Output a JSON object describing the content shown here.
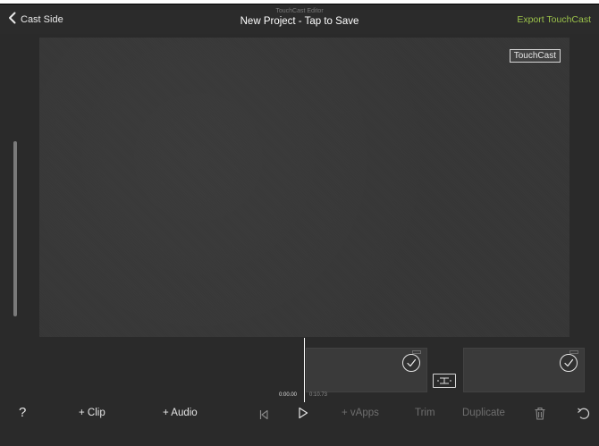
{
  "header": {
    "back_label": "Cast Side",
    "editor_label": "TouchCast Editor",
    "project_title": "New Project - Tap to Save",
    "export_label": "Export TouchCast"
  },
  "preview": {
    "watermark": "TouchCast"
  },
  "timeline": {
    "current_time": "0:00.00",
    "total_time": "0:10.73",
    "clips": [
      {
        "selected": true
      },
      {
        "selected": true
      }
    ]
  },
  "toolbar": {
    "help_label": "?",
    "add_clip_label": "+ Clip",
    "add_audio_label": "+ Audio",
    "vapps_label": "+ vApps",
    "trim_label": "Trim",
    "duplicate_label": "Duplicate"
  },
  "icons": {
    "back": "chevron-left-icon",
    "rewind": "skip-to-start-icon",
    "play": "play-icon",
    "check": "checkmark-icon",
    "transition": "transition-icon",
    "trash": "trash-icon",
    "undo": "undo-icon"
  },
  "colors": {
    "accent": "#9bc24a",
    "background": "#2a2a2a",
    "disabled_text": "#6e6e6e"
  }
}
